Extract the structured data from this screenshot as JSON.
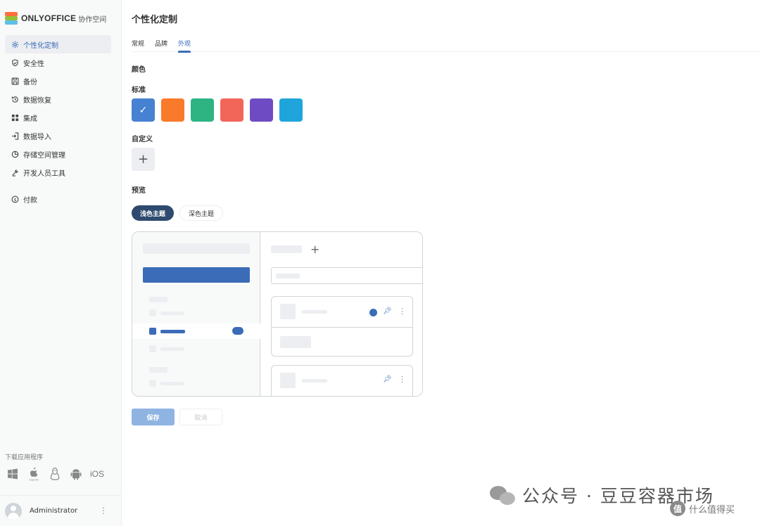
{
  "brand": {
    "name": "ONLYOFFICE",
    "suffix": "协作空间"
  },
  "sidebar": {
    "items": [
      {
        "label": "个性化定制",
        "icon": "gear-icon",
        "active": true
      },
      {
        "label": "安全性",
        "icon": "shield-icon"
      },
      {
        "label": "备份",
        "icon": "save-icon"
      },
      {
        "label": "数据恢复",
        "icon": "history-icon"
      },
      {
        "label": "集成",
        "icon": "grid-icon"
      },
      {
        "label": "数据导入",
        "icon": "import-icon"
      },
      {
        "label": "存储空间管理",
        "icon": "pie-chart-icon"
      },
      {
        "label": "开发人员工具",
        "icon": "tools-icon"
      }
    ],
    "payment": {
      "label": "付款",
      "icon": "dollar-icon"
    },
    "download_label": "下载应用程序",
    "apps": [
      "windows-icon",
      "macos-icon",
      "linux-icon",
      "android-icon"
    ],
    "ios_label": "iOS",
    "user_name": "Administrator"
  },
  "main": {
    "title": "个性化定制",
    "tabs": [
      {
        "label": "常规"
      },
      {
        "label": "品牌"
      },
      {
        "label": "外观",
        "active": true
      }
    ],
    "color_heading": "颜色",
    "standard_heading": "标准",
    "swatches": [
      "#4781d1",
      "#f97a2a",
      "#2db482",
      "#f2665a",
      "#6e4bc3",
      "#1fa5db"
    ],
    "selected_swatch": 0,
    "custom_heading": "自定义",
    "custom_add": "+",
    "preview_heading": "预览",
    "theme_light": "浅色主题",
    "theme_dark": "深色主题",
    "save_label": "保存",
    "cancel_label": "取消"
  },
  "watermark": {
    "text": "公众号 · 豆豆容器市场",
    "site": "什么值得买",
    "badge": "值"
  },
  "colors": {
    "accent": "#3a6cb8",
    "sidebar_bg": "#f8f9f9"
  }
}
